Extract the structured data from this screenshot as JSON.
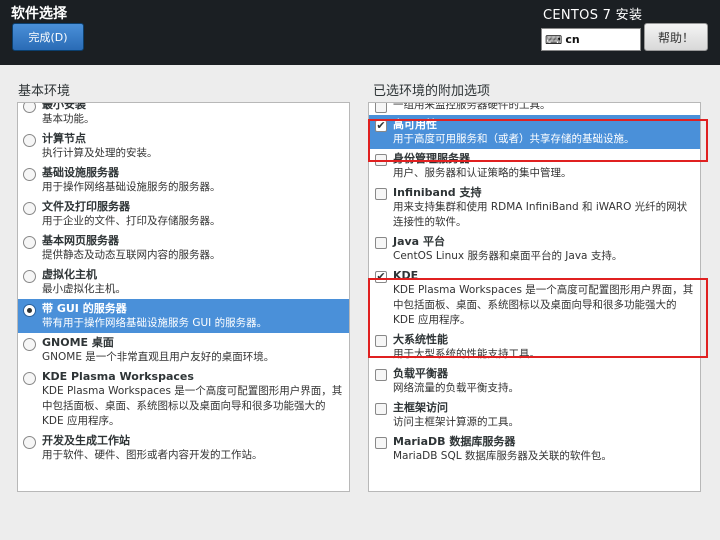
{
  "header": {
    "title": "软件选择",
    "done_label": "完成(D)",
    "install_title": "CENTOS 7 安装",
    "keyboard_layout": "cn",
    "keyboard_icon": "keyboard-icon",
    "help_label": "帮助！"
  },
  "base_env": {
    "title": "基本环境",
    "items": [
      {
        "name": "最小安装",
        "desc": "基本功能。",
        "selected": false
      },
      {
        "name": "计算节点",
        "desc": "执行计算及处理的安装。",
        "selected": false
      },
      {
        "name": "基础设施服务器",
        "desc": "用于操作网络基础设施服务的服务器。",
        "selected": false
      },
      {
        "name": "文件及打印服务器",
        "desc": "用于企业的文件、打印及存储服务器。",
        "selected": false
      },
      {
        "name": "基本网页服务器",
        "desc": "提供静态及动态互联网内容的服务器。",
        "selected": false
      },
      {
        "name": "虚拟化主机",
        "desc": "最小虚拟化主机。",
        "selected": false
      },
      {
        "name": "带 GUI 的服务器",
        "desc": "带有用于操作网络基础设施服务 GUI 的服务器。",
        "selected": true
      },
      {
        "name": "GNOME 桌面",
        "desc": "GNOME 是一个非常直观且用户友好的桌面环境。",
        "selected": false
      },
      {
        "name": "KDE Plasma Workspaces",
        "desc": "KDE Plasma Workspaces 是一个高度可配置图形用户界面，其中包括面板、桌面、系统图标以及桌面向导和很多功能强大的 KDE 应用程序。",
        "selected": false
      },
      {
        "name": "开发及生成工作站",
        "desc": "用于软件、硬件、图形或者内容开发的工作站。",
        "selected": false
      }
    ]
  },
  "addons": {
    "title": "已选环境的附加选项",
    "items": [
      {
        "name": "",
        "desc": "一组用来监控服务器硬件的工具。",
        "checked": false,
        "selected": false
      },
      {
        "name": "高可用性",
        "desc": "用于高度可用服务和（或者）共享存储的基础设施。",
        "checked": true,
        "selected": true
      },
      {
        "name": "身份管理服务器",
        "desc": "用户、服务器和认证策略的集中管理。",
        "checked": false,
        "selected": false
      },
      {
        "name": "Infiniband 支持",
        "desc": "用来支持集群和使用 RDMA InfiniBand 和 iWARO 光纤的网状连接性的软件。",
        "checked": false,
        "selected": false
      },
      {
        "name": "Java 平台",
        "desc": "CentOS Linux 服务器和桌面平台的 Java 支持。",
        "checked": false,
        "selected": false
      },
      {
        "name": "KDE",
        "desc": "KDE Plasma Workspaces 是一个高度可配置图形用户界面，其中包括面板、桌面、系统图标以及桌面向导和很多功能强大的 KDE 应用程序。",
        "checked": true,
        "selected": false
      },
      {
        "name": "大系统性能",
        "desc": "用于大型系统的性能支持工具。",
        "checked": false,
        "selected": false
      },
      {
        "name": "负载平衡器",
        "desc": "网络流量的负载平衡支持。",
        "checked": false,
        "selected": false
      },
      {
        "name": "主框架访问",
        "desc": "访问主框架计算源的工具。",
        "checked": false,
        "selected": false
      },
      {
        "name": "MariaDB 数据库服务器",
        "desc": "MariaDB SQL 数据库服务器及关联的软件包。",
        "checked": false,
        "selected": false
      }
    ]
  },
  "colors": {
    "header_bg": "#1b1f23",
    "selection": "#4a90d9",
    "highlight_box": "#e02020"
  }
}
